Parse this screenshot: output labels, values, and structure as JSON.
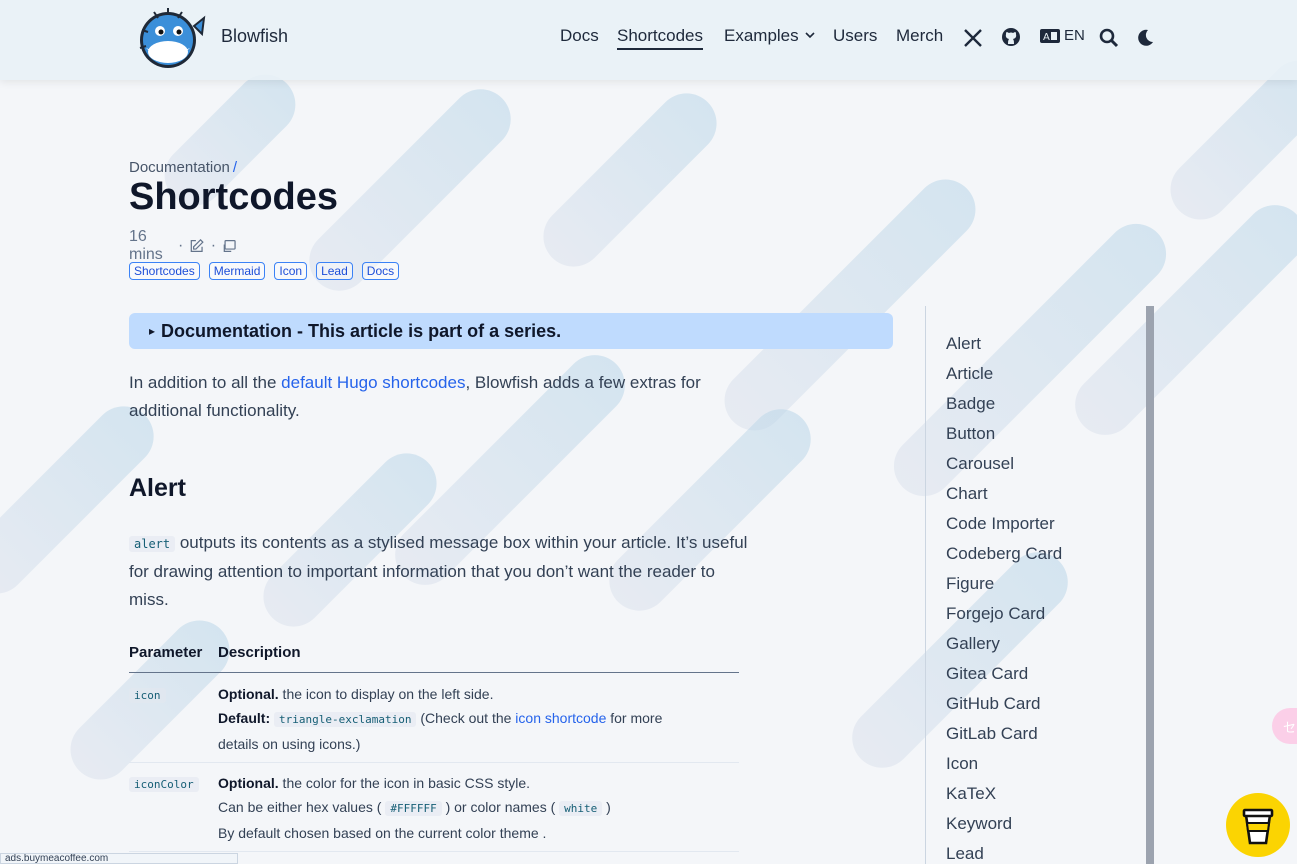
{
  "header": {
    "site_title": "Blowfish",
    "nav": [
      {
        "label": "Docs"
      },
      {
        "label": "Shortcodes"
      },
      {
        "label": "Examples"
      },
      {
        "label": "Users"
      },
      {
        "label": "Merch"
      }
    ],
    "language": "EN",
    "icons": [
      "x-icon",
      "github-icon",
      "language-icon",
      "search-icon",
      "moon-icon"
    ]
  },
  "breadcrumb": {
    "label": "Documentation",
    "separator": "/"
  },
  "page": {
    "title": "Shortcodes",
    "reading_time": "16 mins",
    "dot": "·",
    "tags": [
      "Shortcodes",
      "Mermaid",
      "Icon",
      "Lead",
      "Docs"
    ]
  },
  "series": {
    "label": "Documentation - This article is part of a series.",
    "marker": "▸"
  },
  "intro": {
    "before": "In addition to all the ",
    "link": "default Hugo shortcodes",
    "after": ", Blowfish adds a few extras for additional functionality."
  },
  "alert_section": {
    "heading": "Alert",
    "code": "alert",
    "text": " outputs its contents as a stylised message box within your article. It’s useful for drawing attention to important information that you don’t want the reader to miss."
  },
  "table": {
    "headers": [
      "Parameter",
      "Description"
    ],
    "rows": [
      {
        "param": "icon",
        "line1_bold": "Optional.",
        "line1": " the icon to display on the left side.",
        "line2_bold": "Default:",
        "line2_code": "triangle-exclamation",
        "line2_before": " (Check out the ",
        "line2_link": "icon shortcode",
        "line2_after": " for more",
        "line3": "details on using icons.)"
      },
      {
        "param": "iconColor",
        "line1_bold": "Optional.",
        "line1": " the color for the icon in basic CSS style.",
        "line2_before": "Can be either hex values ( ",
        "line2_code1": "#FFFFFF",
        "line2_mid": " ) or color names ( ",
        "line2_code2": "white",
        "line2_after": " )",
        "line3": "By default chosen based on the current color theme ."
      }
    ]
  },
  "toc": [
    "Alert",
    "Article",
    "Badge",
    "Button",
    "Carousel",
    "Chart",
    "Code Importer",
    "Codeberg Card",
    "Figure",
    "Forgejo Card",
    "Gallery",
    "Gitea Card",
    "GitHub Card",
    "GitLab Card",
    "Icon",
    "KaTeX",
    "Keyword",
    "Lead"
  ],
  "status_bar": "ads.buymeacoffee.com",
  "side_tab": "セ",
  "colors": {
    "accent": "#2563eb",
    "series_bg": "#bfdbfe",
    "coffee": "#fbd402"
  }
}
